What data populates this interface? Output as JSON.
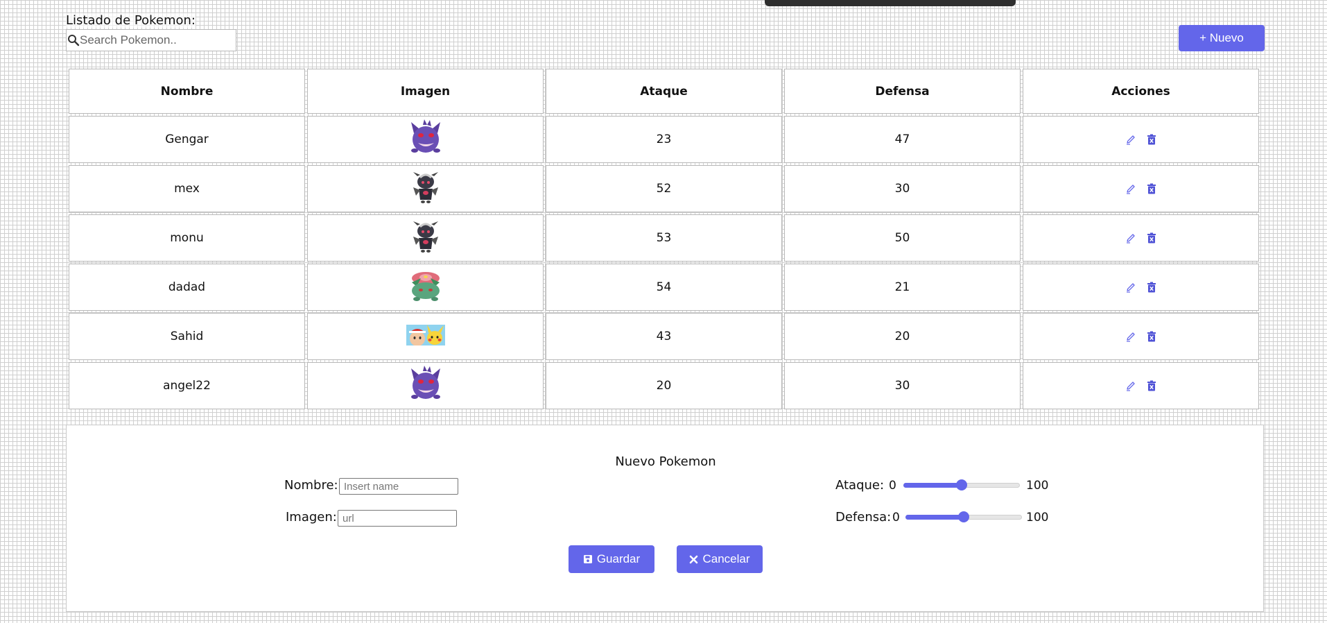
{
  "header": {
    "title": "Listado de Pokemon:",
    "search_placeholder": "Search Pokemon..",
    "new_button": "+ Nuevo"
  },
  "table": {
    "columns": [
      "Nombre",
      "Imagen",
      "Ataque",
      "Defensa",
      "Acciones"
    ],
    "rows": [
      {
        "nombre": "Gengar",
        "image": "gengar",
        "ataque": "23",
        "defensa": "47"
      },
      {
        "nombre": "mex",
        "image": "dark-figure",
        "ataque": "52",
        "defensa": "30"
      },
      {
        "nombre": "monu",
        "image": "dark-figure",
        "ataque": "53",
        "defensa": "50"
      },
      {
        "nombre": "dadad",
        "image": "venusaur",
        "ataque": "54",
        "defensa": "21"
      },
      {
        "nombre": "Sahid",
        "image": "ash-pikachu",
        "ataque": "43",
        "defensa": "20"
      },
      {
        "nombre": "angel22",
        "image": "gengar",
        "ataque": "20",
        "defensa": "30"
      }
    ],
    "action_icons": [
      "pencil-icon",
      "trash-icon"
    ]
  },
  "form": {
    "title": "Nuevo Pokemon",
    "nombre_label": "Nombre:",
    "nombre_placeholder": "Insert name",
    "imagen_label": "Imagen:",
    "imagen_placeholder": "url",
    "ataque_label": "Ataque:",
    "ataque_min": "0",
    "ataque_max": "100",
    "ataque_value": 50,
    "defensa_label": "Defensa:",
    "defensa_min": "0",
    "defensa_max": "100",
    "defensa_value": 50,
    "save_button": "Guardar",
    "cancel_button": "Cancelar"
  },
  "colors": {
    "accent": "#6366ea",
    "dark_strip": "#2f2f2f"
  }
}
